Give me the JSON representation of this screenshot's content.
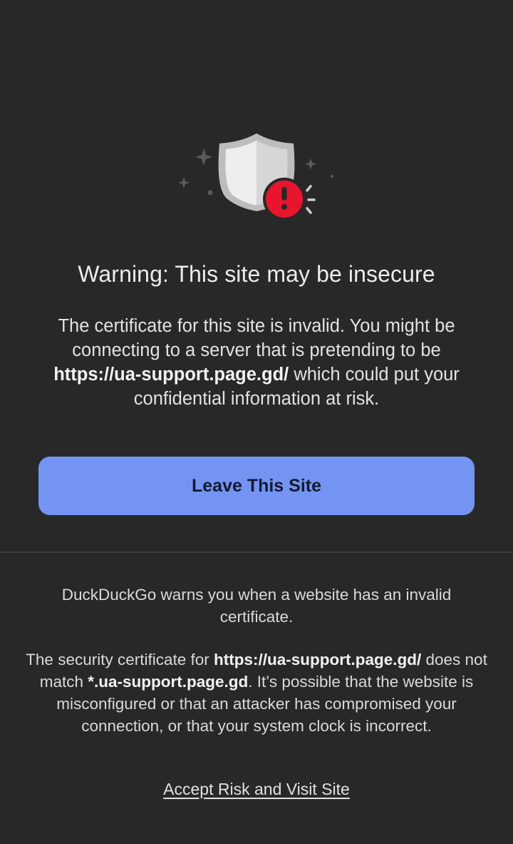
{
  "warning": {
    "title": "Warning: This site may be insecure",
    "message_part1": "The certificate for this site is invalid. You might be connecting to a server that is pretending to be ",
    "message_url": "https://ua-support.page.gd/",
    "message_part2": " which could put your confidential information at risk."
  },
  "actions": {
    "leave_label": "Leave This Site",
    "accept_label": "Accept Risk and Visit Site"
  },
  "details": {
    "paragraph1": "DuckDuckGo warns you when a website has an invalid certificate.",
    "p2_part1": "The security certificate for ",
    "p2_url": "https://ua-support.page.gd/",
    "p2_part2": " does not match ",
    "p2_cert": "*.ua-support.page.gd",
    "p2_part3": ". It’s possible that the website is misconfigured or that an attacker has compromised your connection, or that your system clock is incorrect."
  },
  "icons": {
    "hero": "shield-warning-icon"
  },
  "colors": {
    "background": "#282828",
    "button": "#7394f3",
    "alert": "#e8162d"
  }
}
